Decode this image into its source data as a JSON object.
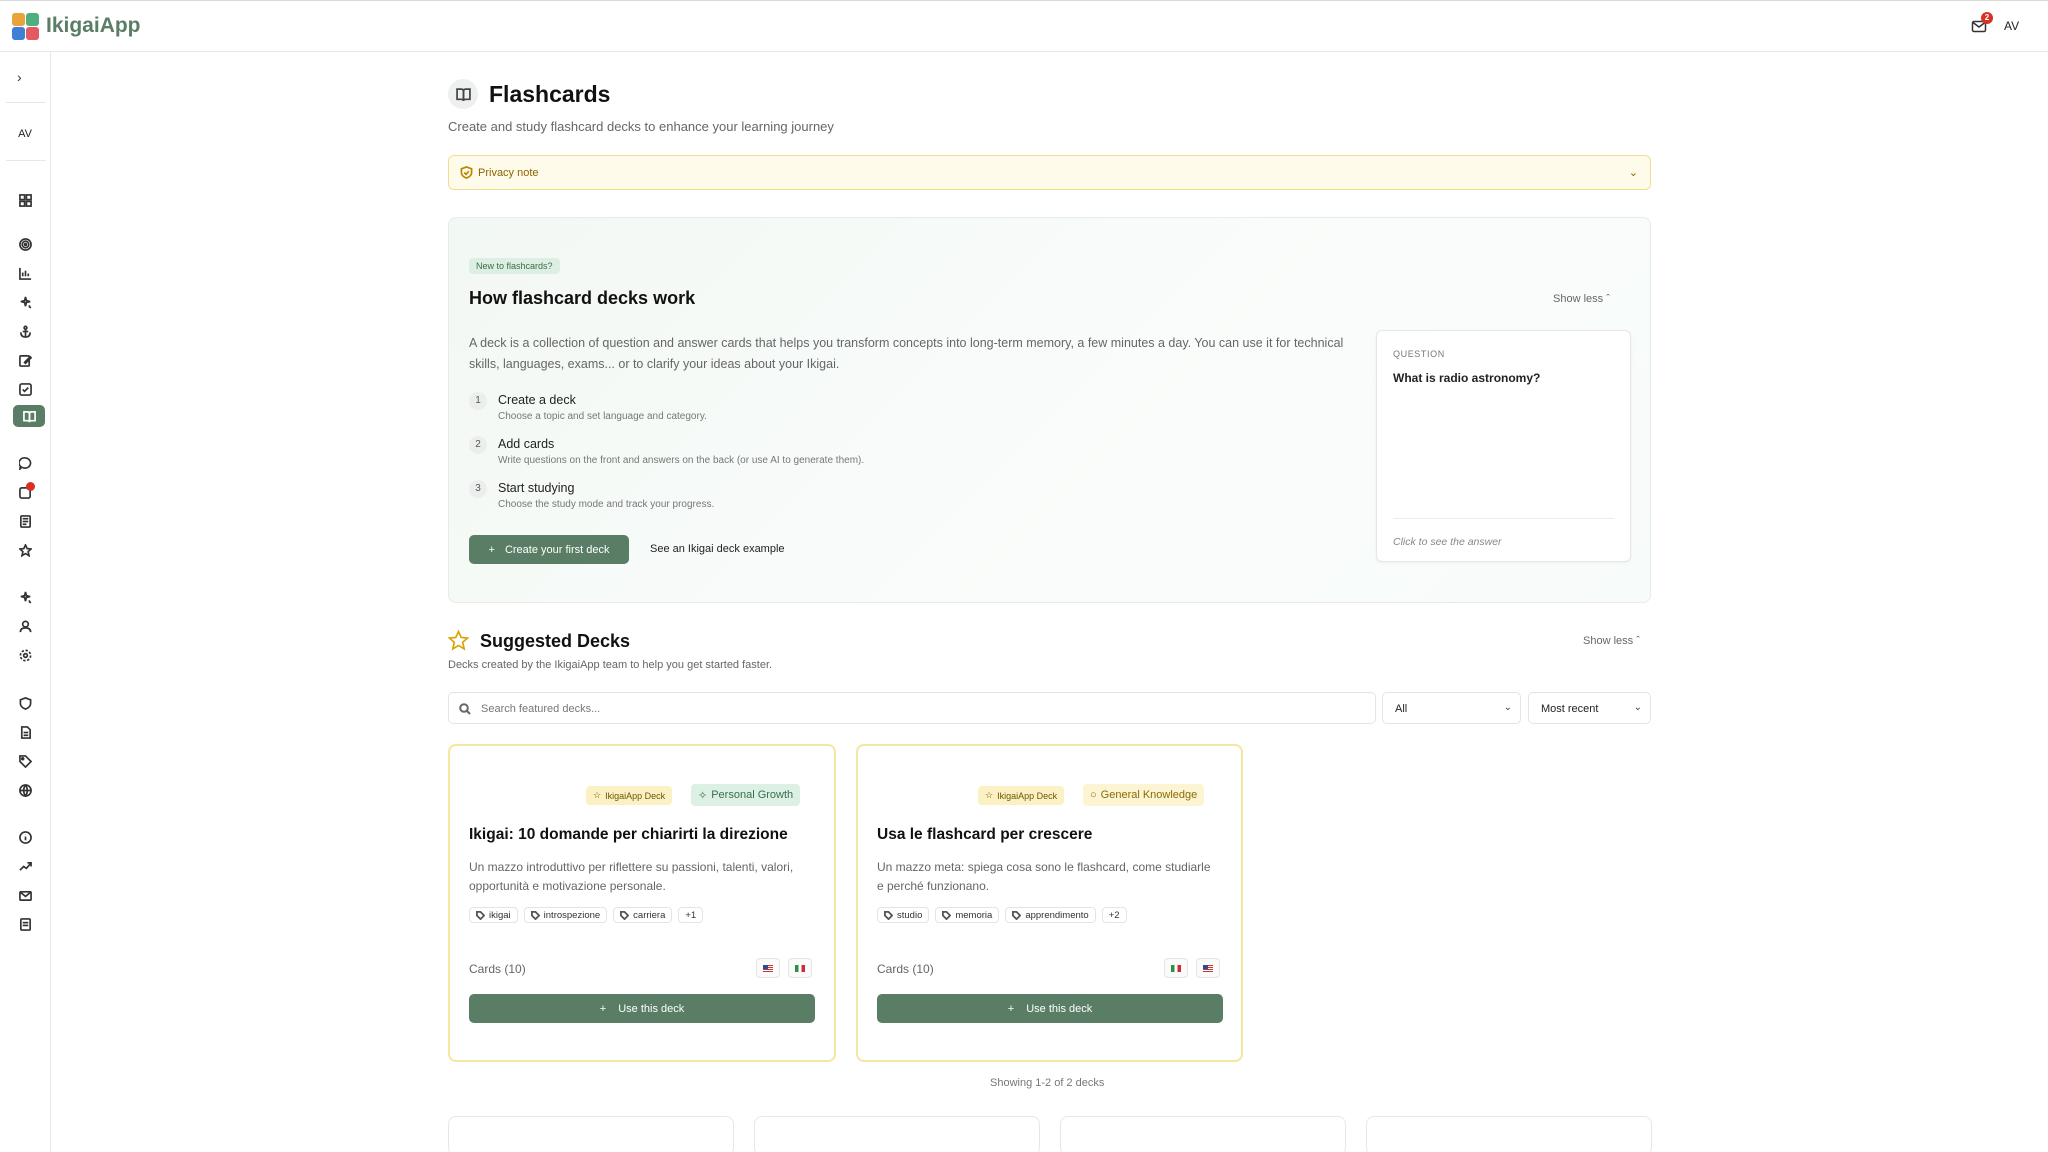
{
  "app": {
    "name": "IkigaiApp",
    "user_initials": "AV",
    "mail_badge": "2"
  },
  "sidebar": {
    "toggle": "›",
    "avatar": "AV",
    "icons": [
      "dashboard-icon",
      "target-icon",
      "chart-icon",
      "sparkles-icon",
      "anchor-icon",
      "edit-icon",
      "check-square-icon",
      "book-open-icon",
      "message-icon",
      "notification-icon",
      "news-icon",
      "star-icon",
      "sparkles-icon",
      "user-icon",
      "settings-icon",
      "shield-icon",
      "document-icon",
      "tag-icon",
      "globe-icon",
      "info-icon",
      "trending-icon",
      "mail-icon",
      "file-icon"
    ],
    "active": "book-open-icon"
  },
  "header": {
    "title": "Flashcards",
    "subtitle": "Create and study flashcard decks to enhance your learning journey"
  },
  "privacy": {
    "label": "Privacy note"
  },
  "how": {
    "pill": "New to flashcards?",
    "title": "How flashcard decks work",
    "show_less": "Show less",
    "description": "A deck is a collection of question and answer cards that helps you transform concepts into long-term memory, a few minutes a day. You can use it for technical skills, languages, exams... or to clarify your ideas about your Ikigai.",
    "steps": [
      {
        "num": "1",
        "title": "Create a deck",
        "sub": "Choose a topic and set language and category."
      },
      {
        "num": "2",
        "title": "Add cards",
        "sub": "Write questions on the front and answers on the back (or use AI to generate them)."
      },
      {
        "num": "3",
        "title": "Start studying",
        "sub": "Choose the study mode and track your progress."
      }
    ],
    "create_button": "Create your first deck",
    "example_link": "See an Ikigai deck example",
    "question_card": {
      "label": "QUESTION",
      "text": "What is radio astronomy?",
      "hint": "Click to see the answer"
    }
  },
  "suggested": {
    "title": "Suggested Decks",
    "subtitle": "Decks created by the IkigaiApp team to help you get started faster.",
    "show_less": "Show less",
    "search_placeholder": "Search featured decks...",
    "filter_value": "All",
    "sort_value": "Most recent",
    "decks": [
      {
        "badge": "IkigaiApp Deck",
        "category": "Personal Growth",
        "title": "Ikigai: 10 domande per chiarirti la direzione",
        "description": "Un mazzo introduttivo per riflettere su passioni, talenti, valori, opportunità e motivazione personale.",
        "tags": [
          "ikigai",
          "introspezione",
          "carriera"
        ],
        "more_tags": "+1",
        "cards": "Cards (10)",
        "flags": [
          "us",
          "it"
        ],
        "button": "Use this deck"
      },
      {
        "badge": "IkigaiApp Deck",
        "category": "General Knowledge",
        "title": "Usa le flashcard per crescere",
        "description": "Un mazzo meta: spiega cosa sono le flashcard, come studiarle e perché funzionano.",
        "tags": [
          "studio",
          "memoria",
          "apprendimento"
        ],
        "more_tags": "+2",
        "cards": "Cards (10)",
        "flags": [
          "it",
          "us"
        ],
        "button": "Use this deck"
      }
    ],
    "showing": "Showing 1-2 of 2 decks"
  },
  "colors": {
    "accent": "#5a7d66",
    "privacy_bg": "#fffbea",
    "deck_border": "#f5e6a0",
    "badge_red": "#d93025"
  }
}
